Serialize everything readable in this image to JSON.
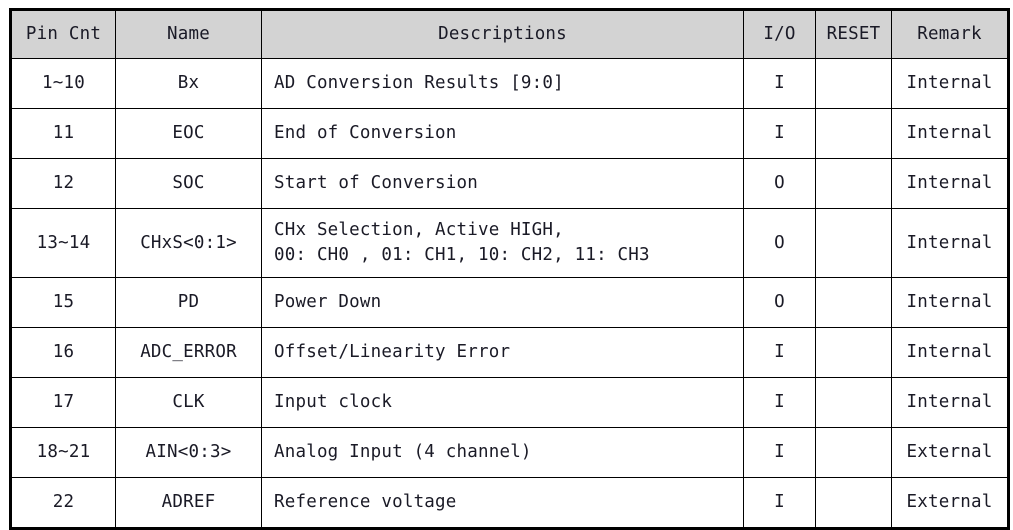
{
  "table": {
    "columns": [
      {
        "key": "pin",
        "label": "Pin Cnt"
      },
      {
        "key": "name",
        "label": "Name"
      },
      {
        "key": "desc",
        "label": "Descriptions"
      },
      {
        "key": "io",
        "label": "I/O"
      },
      {
        "key": "reset",
        "label": "RESET"
      },
      {
        "key": "remark",
        "label": "Remark"
      }
    ],
    "rows": [
      {
        "pin": "1~10",
        "name": "Bx",
        "desc_lines": [
          "AD Conversion Results [9:0]"
        ],
        "io": "I",
        "reset": "",
        "remark": "Internal"
      },
      {
        "pin": "11",
        "name": "EOC",
        "desc_lines": [
          "End of Conversion"
        ],
        "io": "I",
        "reset": "",
        "remark": "Internal"
      },
      {
        "pin": "12",
        "name": "SOC",
        "desc_lines": [
          "Start of Conversion"
        ],
        "io": "O",
        "reset": "",
        "remark": "Internal"
      },
      {
        "pin": "13~14",
        "name": "CHxS<0:1>",
        "desc_lines": [
          "CHx Selection, Active HIGH,",
          "00: CH0 , 01: CH1, 10: CH2, 11: CH3"
        ],
        "io": "O",
        "reset": "",
        "remark": "Internal"
      },
      {
        "pin": "15",
        "name": "PD",
        "desc_lines": [
          "Power Down"
        ],
        "io": "O",
        "reset": "",
        "remark": "Internal"
      },
      {
        "pin": "16",
        "name": "ADC_ERROR",
        "desc_lines": [
          "Offset/Linearity Error"
        ],
        "io": "I",
        "reset": "",
        "remark": "Internal"
      },
      {
        "pin": "17",
        "name": "CLK",
        "desc_lines": [
          "Input clock"
        ],
        "io": "I",
        "reset": "",
        "remark": "Internal"
      },
      {
        "pin": "18~21",
        "name": "AIN<0:3>",
        "desc_lines": [
          "Analog Input (4 channel)"
        ],
        "io": "I",
        "reset": "",
        "remark": "External"
      },
      {
        "pin": "22",
        "name": "ADREF",
        "desc_lines": [
          "Reference voltage"
        ],
        "io": "I",
        "reset": "",
        "remark": "External"
      }
    ]
  },
  "style": {
    "header_background": "#d3d3d3",
    "border_color": "#000000",
    "text_color": "#1a1a26",
    "page_background": "#ffffff"
  }
}
